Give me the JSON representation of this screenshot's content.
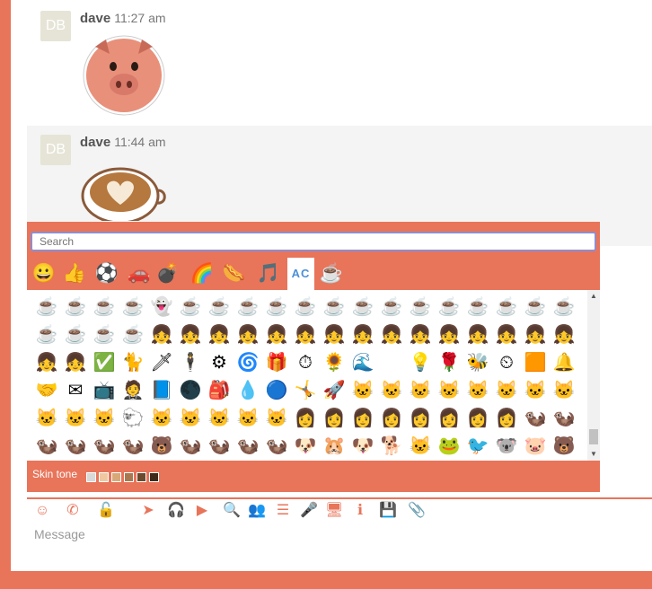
{
  "messages": [
    {
      "avatar": "DB",
      "user": "dave",
      "time": "11:27 am",
      "sticker": "pig-sticker"
    },
    {
      "avatar": "DB",
      "user": "dave",
      "time": "11:44 am",
      "sticker": "coffee-heart-sticker"
    }
  ],
  "picker": {
    "search_placeholder": "Search",
    "categories": [
      {
        "name": "smileys",
        "glyph": "😀"
      },
      {
        "name": "people",
        "glyph": "👍"
      },
      {
        "name": "activity",
        "glyph": "⚽"
      },
      {
        "name": "travel",
        "glyph": "🚗"
      },
      {
        "name": "objects",
        "glyph": "💣"
      },
      {
        "name": "symbols",
        "glyph": "🌈"
      },
      {
        "name": "food",
        "glyph": "🌭"
      },
      {
        "name": "music",
        "glyph": "🎵"
      },
      {
        "name": "custom",
        "glyph": "AC"
      },
      {
        "name": "stickers",
        "glyph": "☕"
      }
    ],
    "active_category": "custom",
    "grid": [
      "☕",
      "☕",
      "☕",
      "☕",
      "👻",
      "☕",
      "☕",
      "☕",
      "☕",
      "☕",
      "☕",
      "☕",
      "☕",
      "☕",
      "☕",
      "☕",
      "☕",
      "☕",
      "☕",
      "☕",
      "☕",
      "☕",
      "☕",
      "👧",
      "👧",
      "👧",
      "👧",
      "👧",
      "👧",
      "👧",
      "👧",
      "👧",
      "👧",
      "👧",
      "👧",
      "👧",
      "👧",
      "👧",
      "👧",
      "👧",
      "✅",
      "🐈",
      "🗡",
      "🕴",
      "⚙",
      "🌀",
      "🎁",
      "⏱",
      "🌻",
      "🌊",
      "",
      "💡",
      "🌹",
      "🐝",
      "⏲",
      "🟧",
      "🔔",
      "🤝",
      "✉",
      "📺",
      "🤵",
      "📘",
      "🌑",
      "🎒",
      "💧",
      "🔵",
      "🤸",
      "🚀",
      "🐱",
      "🐱",
      "🐱",
      "🐱",
      "🐱",
      "🐱",
      "🐱",
      "🐱",
      "🐱",
      "🐱",
      "🐱",
      "🐑",
      "🐱",
      "🐱",
      "🐱",
      "🐱",
      "🐱",
      "👩",
      "👩",
      "👩",
      "👩",
      "👩",
      "👩",
      "👩",
      "👩",
      "🦦",
      "🦦",
      "🦦",
      "🦦",
      "🦦",
      "🦦",
      "🐻",
      "🦦",
      "🦦",
      "🦦",
      "🦦",
      "🐶",
      "🐹",
      "🐶",
      "🐕",
      "🐱",
      "🐸",
      "🐦",
      "🐨",
      "🐷",
      "🐻"
    ],
    "skin_tone_label": "Skin tone",
    "skin_tones": [
      "#d9d9d9",
      "#f0c8a0",
      "#d9a878",
      "#a87850",
      "#6b4a2e",
      "#3d2a1a"
    ]
  },
  "toolbar_icons": [
    "smiley-icon",
    "phone-icon",
    "lock-open-icon",
    "location-arrow-icon",
    "headset-icon",
    "video-icon",
    "search-icon",
    "people-icon",
    "list-icon",
    "microphone-icon",
    "desktop-icon",
    "info-icon",
    "save-icon",
    "paperclip-icon"
  ],
  "toolbar_glyphs": [
    "☺",
    "✆",
    "🔓",
    "➤",
    "🎧",
    "▶",
    "🔍",
    "👥",
    "☰",
    "🎤",
    "🖥",
    "ℹ",
    "💾",
    "📎"
  ],
  "composer": {
    "placeholder": "Message"
  },
  "colors": {
    "accent": "#e8745a",
    "search_border": "#8e8ecf",
    "avatar_bg": "#e6e4d6"
  }
}
